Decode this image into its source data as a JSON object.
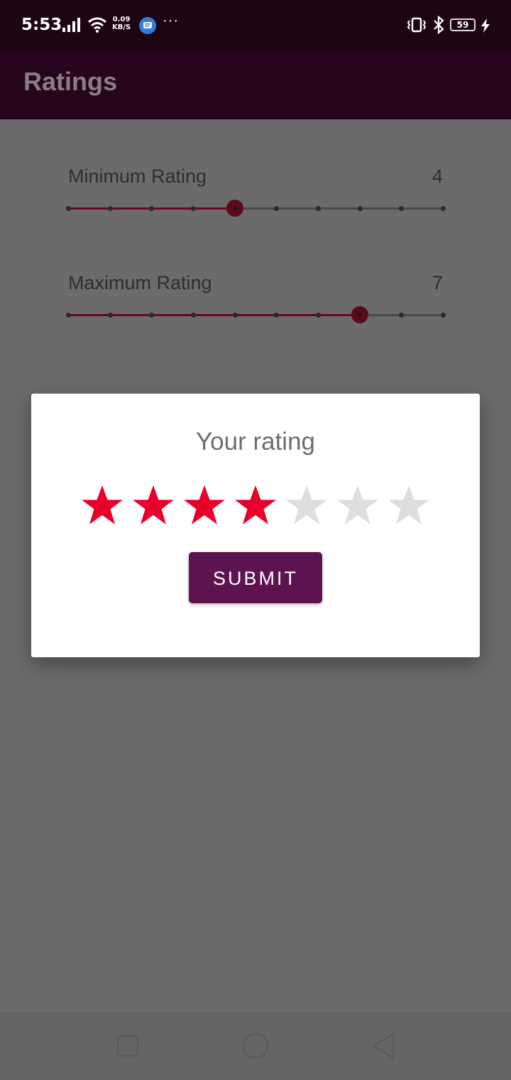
{
  "status_bar": {
    "time": "5:53",
    "net_speed_value": "0.09",
    "net_speed_unit": "KB/S",
    "overflow": "···",
    "battery": "59"
  },
  "app_bar": {
    "title": "Ratings"
  },
  "sliders": [
    {
      "label": "Minimum Rating",
      "value": "4",
      "steps": 10,
      "selected_index": 4
    },
    {
      "label": "Maximum Rating",
      "value": "7",
      "steps": 10,
      "selected_index": 7
    }
  ],
  "dialog": {
    "title": "Your rating",
    "rating": 4,
    "max_rating": 7,
    "submit_label": "SUBMIT"
  },
  "colors": {
    "star_filled": "#e8002a",
    "star_empty": "#dedede",
    "accent": "#5c1350",
    "app_bar": "#28051f"
  },
  "nav": {
    "icons": [
      "square-icon",
      "circle-icon",
      "triangle-back-icon"
    ]
  }
}
